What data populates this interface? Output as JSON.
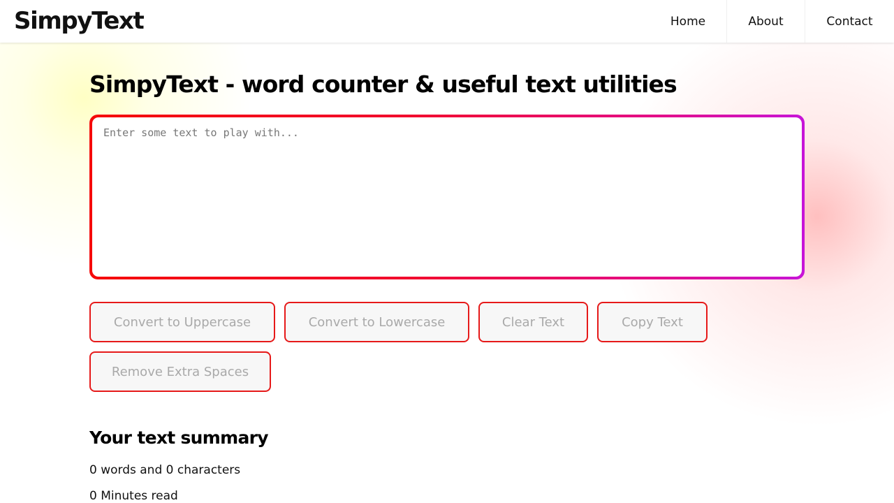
{
  "header": {
    "brand": "SimpyText",
    "nav": [
      {
        "label": "Home"
      },
      {
        "label": "About"
      },
      {
        "label": "Contact"
      }
    ]
  },
  "main": {
    "title": "SimpyText - word counter & useful text utilities",
    "textarea": {
      "placeholder": "Enter some text to play with...",
      "value": ""
    },
    "buttons": {
      "uppercase": "Convert to Uppercase",
      "lowercase": "Convert to Lowercase",
      "clear": "Clear Text",
      "copy": "Copy Text",
      "remove_spaces": "Remove Extra Spaces"
    },
    "summary": {
      "heading": "Your text summary",
      "counts": "0 words and 0 characters",
      "read_time": "0 Minutes read"
    }
  },
  "colors": {
    "accent_red": "#e61919",
    "gradient_start": "#f50a0a",
    "gradient_end": "#c714d8",
    "button_text_disabled": "#a9a9a9"
  }
}
